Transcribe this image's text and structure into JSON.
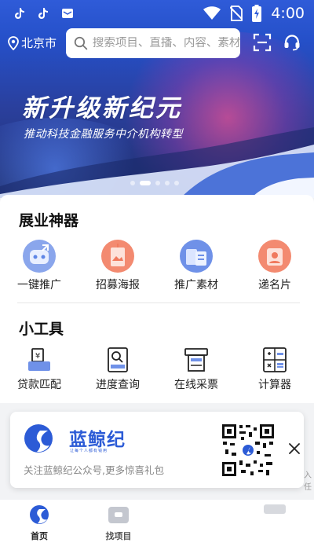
{
  "status_bar": {
    "time": "4:00"
  },
  "header": {
    "city": "北京市",
    "search_placeholder": "搜索项目、直播、内容、素材"
  },
  "banner": {
    "headline": "新升级新纪元",
    "subline": "推动科技金融服务中介机构转型",
    "slide_count": 5,
    "active_slide": 1
  },
  "sections": [
    {
      "title": "展业神器",
      "items": [
        {
          "label": "一键推广",
          "icon": "robot-icon",
          "color": "#7f9ee8"
        },
        {
          "label": "招募海报",
          "icon": "poster-icon",
          "color": "#f07a5e"
        },
        {
          "label": "推广素材",
          "icon": "material-icon",
          "color": "#5f86e6"
        },
        {
          "label": "递名片",
          "icon": "card-icon",
          "color": "#f07a5e"
        }
      ]
    },
    {
      "title": "小工具",
      "items": [
        {
          "label": "贷款匹配",
          "icon": "loan-icon"
        },
        {
          "label": "进度查询",
          "icon": "progress-search-icon"
        },
        {
          "label": "在线采票",
          "icon": "ticket-icon"
        },
        {
          "label": "计算器",
          "icon": "calculator-icon"
        }
      ]
    }
  ],
  "promo": {
    "brand": "蓝鲸纪",
    "brand_tagline": "让每个人都有钱用",
    "text": "关注蓝鲸纪公众号,更多惊喜礼包",
    "edge_text": "入任"
  },
  "tabs": [
    {
      "label": "首页",
      "active": true
    },
    {
      "label": "找项目",
      "active": false
    }
  ],
  "colors": {
    "primary": "#2c5bd6",
    "accent": "#f07a5e",
    "text": "#222222"
  }
}
